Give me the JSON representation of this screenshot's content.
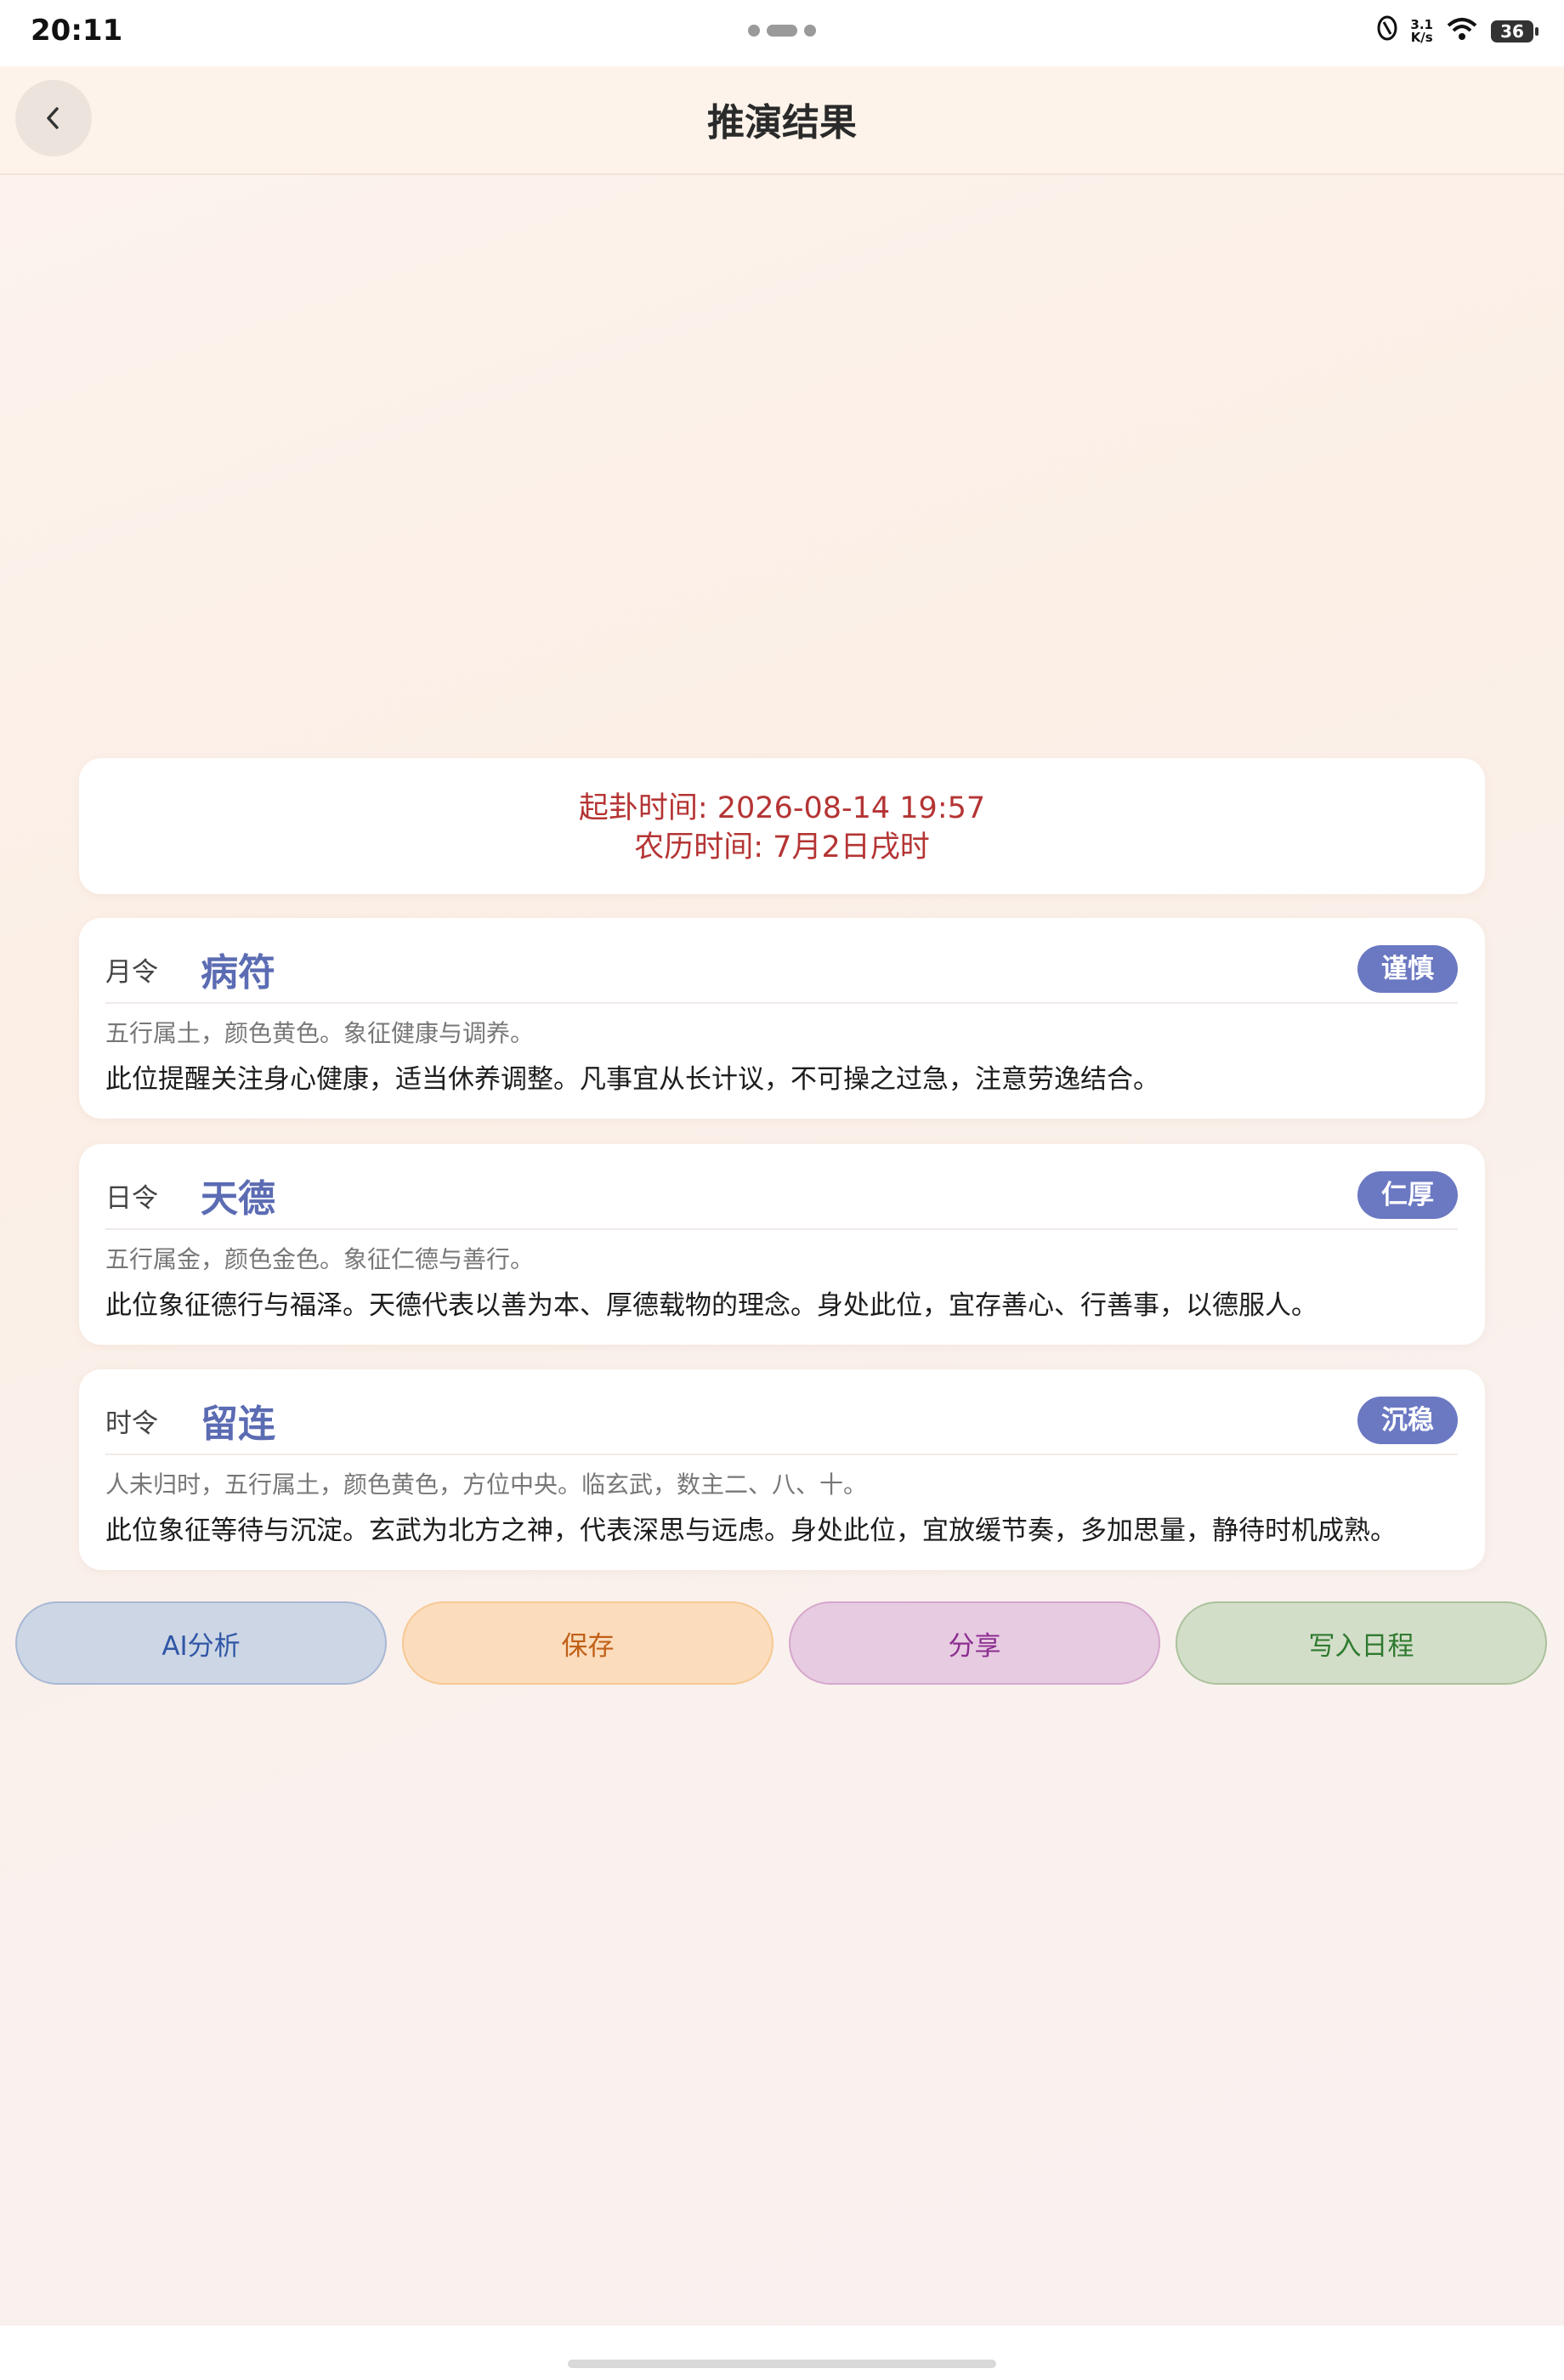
{
  "status_bar": {
    "time": "20:11",
    "netspeed_value": "3.1",
    "netspeed_unit": "K/s",
    "battery": "36"
  },
  "header": {
    "title": "推演结果"
  },
  "time_info": {
    "start_time": "起卦时间: 2026-08-14 19:57",
    "lunar_time": "农历时间: 7月2日戌时"
  },
  "results": [
    {
      "label": "月令",
      "name": "病符",
      "badge": "谨慎",
      "attributes": "五行属土，颜色黄色。象征健康与调养。",
      "description": "此位提醒关注身心健康，适当休养调整。凡事宜从长计议，不可操之过急，注意劳逸结合。"
    },
    {
      "label": "日令",
      "name": "天德",
      "badge": "仁厚",
      "attributes": "五行属金，颜色金色。象征仁德与善行。",
      "description": "此位象征德行与福泽。天德代表以善为本、厚德载物的理念。身处此位，宜存善心、行善事，以德服人。"
    },
    {
      "label": "时令",
      "name": "留连",
      "badge": "沉稳",
      "attributes": "人未归时，五行属土，颜色黄色，方位中央。临玄武，数主二、八、十。",
      "description": "此位象征等待与沉淀。玄武为北方之神，代表深思与远虑。身处此位，宜放缓节奏，多加思量，静待时机成熟。"
    }
  ],
  "actions": {
    "ai_label": "AI分析",
    "save_label": "保存",
    "share_label": "分享",
    "calendar_label": "写入日程"
  },
  "colors": {
    "accent_name": "#5b6cb3",
    "badge_bg": "#6b78c2",
    "time_text": "#b53434"
  }
}
